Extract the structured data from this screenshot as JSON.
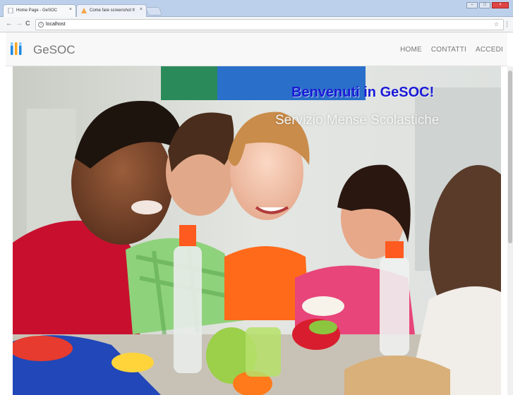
{
  "browser": {
    "tabs": [
      {
        "title": "Home Page - GeSOC",
        "close": "×"
      },
      {
        "title": "Come fare screenshot fr",
        "close": "×"
      }
    ],
    "address": "localhost",
    "nav_back": "←",
    "nav_forward": "→",
    "nav_reload": "C",
    "info_glyph": "i",
    "star_glyph": "☆",
    "menu_glyph": "⋮",
    "window_controls": {
      "minimize": "–",
      "maximize": "□",
      "close": "×"
    }
  },
  "navbar": {
    "brand": "GeSOC",
    "links": [
      "HOME",
      "CONTATTI",
      "ACCEDI"
    ],
    "logo_colors": [
      "#1e88e5",
      "#f9a825",
      "#1e88e5"
    ]
  },
  "hero": {
    "title": "Benvenuti in GeSOC!",
    "subtitle": "Servizio Mense Scolastiche",
    "title_color": "#1a1ad6"
  },
  "icons": {
    "info": "info-icon",
    "star": "star-icon",
    "menu": "menu-icon",
    "back": "back-arrow-icon",
    "forward": "forward-arrow-icon",
    "reload": "reload-icon",
    "logo": "cutlery-logo-icon"
  }
}
